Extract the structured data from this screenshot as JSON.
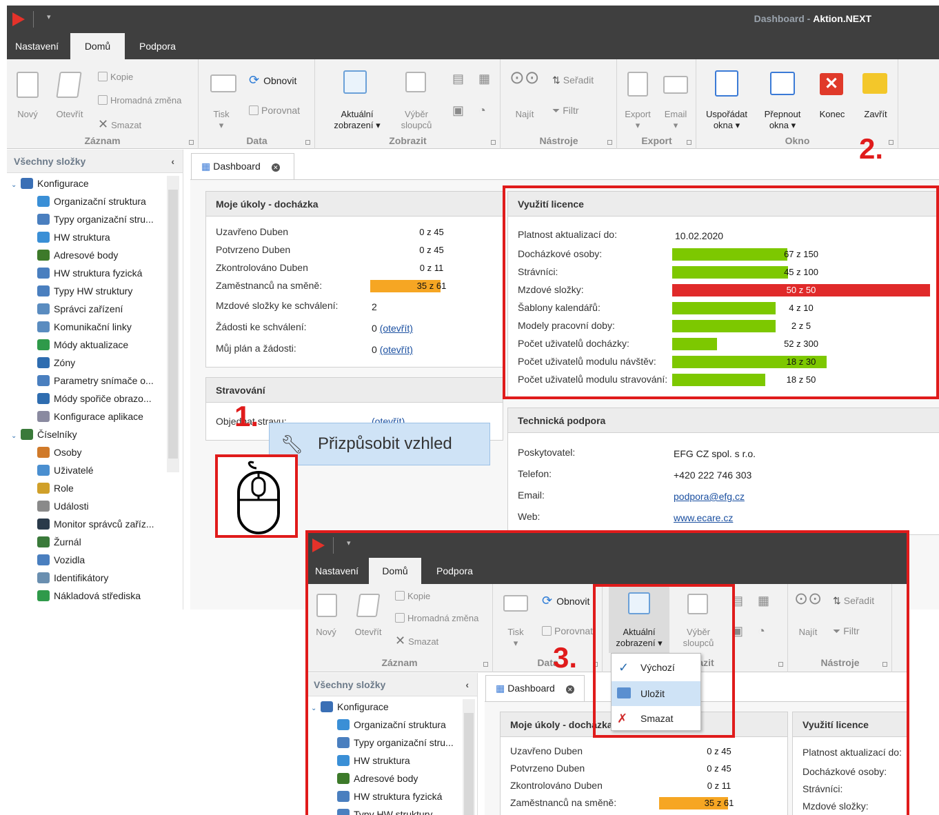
{
  "window": {
    "title_dim": "Dashboard",
    "title_sep": " - ",
    "title_app": "Aktion.NEXT"
  },
  "tabs": [
    "Nastavení",
    "Domů",
    "Podpora"
  ],
  "ribbon": {
    "zaznam": {
      "label": "Záznam",
      "novy": "Nový",
      "otevrit": "Otevřít",
      "kopie": "Kopie",
      "hromadna": "Hromadná změna",
      "smazat": "Smazat"
    },
    "data": {
      "label": "Data",
      "tisk": "Tisk",
      "obnovit": "Obnovit",
      "porovnat": "Porovnat"
    },
    "zobrazit": {
      "label": "Zobrazit",
      "aktualni": "Aktuální",
      "zobrazeni": "zobrazení",
      "vyber": "Výběr",
      "sloupcu": "sloupců"
    },
    "nastroje": {
      "label": "Nástroje",
      "najit": "Najít",
      "seradit": "Seřadit",
      "filtr": "Filtr"
    },
    "export": {
      "label": "Export",
      "export": "Export",
      "email": "Email"
    },
    "okno": {
      "label": "Okno",
      "usporadat": "Uspořádat",
      "okna": "okna",
      "prepnout": "Přepnout",
      "konec": "Konec",
      "zavrit": "Zavřít"
    }
  },
  "sidebar": {
    "header": "Všechny složky",
    "items": [
      {
        "label": "Konfigurace",
        "color": "#3a6fb5",
        "level": 0
      },
      {
        "label": "Organizační struktura",
        "color": "#3a8fd6",
        "level": 1
      },
      {
        "label": "Typy organizační stru...",
        "color": "#4a7fbf",
        "level": 1
      },
      {
        "label": "HW struktura",
        "color": "#3a8fd6",
        "level": 1
      },
      {
        "label": "Adresové body",
        "color": "#3d7a2a",
        "level": 1
      },
      {
        "label": "HW struktura fyzická",
        "color": "#4a7fbf",
        "level": 1
      },
      {
        "label": "Typy HW struktury",
        "color": "#4a7fbf",
        "level": 1
      },
      {
        "label": "Správci zařízení",
        "color": "#5a8cc0",
        "level": 1
      },
      {
        "label": "Komunikační linky",
        "color": "#5a8cc0",
        "level": 1
      },
      {
        "label": "Módy aktualizace",
        "color": "#2f9a4a",
        "level": 1
      },
      {
        "label": "Zóny",
        "color": "#2f6db0",
        "level": 1
      },
      {
        "label": "Parametry snímače o...",
        "color": "#4a7fbf",
        "level": 1
      },
      {
        "label": "Módy spořiče obrazo...",
        "color": "#2f6db0",
        "level": 1
      },
      {
        "label": "Konfigurace aplikace",
        "color": "#8a8aa0",
        "level": 1
      },
      {
        "label": "Číselníky",
        "color": "#3a7a3a",
        "level": 0
      },
      {
        "label": "Osoby",
        "color": "#d07a2a",
        "level": 1
      },
      {
        "label": "Uživatelé",
        "color": "#4a8fd0",
        "level": 1
      },
      {
        "label": "Role",
        "color": "#d0a02a",
        "level": 1
      },
      {
        "label": "Události",
        "color": "#8a8a8a",
        "level": 1
      },
      {
        "label": "Monitor správců zaříz...",
        "color": "#2a3a4a",
        "level": 1
      },
      {
        "label": "Žurnál",
        "color": "#3a7a3a",
        "level": 1
      },
      {
        "label": "Vozidla",
        "color": "#4a7fbf",
        "level": 1
      },
      {
        "label": "Identifikátory",
        "color": "#6a8fb0",
        "level": 1
      },
      {
        "label": "Nákladová střediska",
        "color": "#2f9a4a",
        "level": 1
      }
    ]
  },
  "doc_tab": "Dashboard",
  "ukoly": {
    "title": "Moje úkoly - docházka",
    "rows": [
      {
        "label": "Uzavřeno Duben",
        "value": "0 z 45"
      },
      {
        "label": "Potvrzeno Duben",
        "value": "0 z 45"
      },
      {
        "label": "Zkontrolováno Duben",
        "value": "0 z 11"
      },
      {
        "label": "Zaměstnanců na směně:",
        "value": "35 z 61",
        "progress": 0.574
      }
    ],
    "schvaleni_label": "Mzdové složky ke schválení:",
    "schvaleni_value": "2",
    "zadosti_label": "Žádosti ke schválení:",
    "zadosti_value": "0",
    "plan_label": "Můj plán a žádosti:",
    "plan_value": "0",
    "link": "(otevřít)"
  },
  "stravovani": {
    "title": "Stravování",
    "label": "Objednat stravu:",
    "link": "(otevřít)"
  },
  "licence": {
    "title": "Využití licence",
    "platnost_label": "Platnost aktualizací do:",
    "platnost_value": "10.02.2020",
    "rows": [
      {
        "label": "Docházkové osoby:",
        "value": "67 z 150",
        "progress": 0.4467,
        "color": "#7dc800"
      },
      {
        "label": "Strávníci:",
        "value": "45 z 100",
        "progress": 0.45,
        "color": "#7dc800"
      },
      {
        "label": "Mzdové složky:",
        "value": "50 z 50",
        "progress": 1.0,
        "color": "#e02a2a"
      },
      {
        "label": "Šablony kalendářů:",
        "value": "4 z 10",
        "progress": 0.4,
        "color": "#7dc800"
      },
      {
        "label": "Modely pracovní doby:",
        "value": "2 z 5",
        "progress": 0.4,
        "color": "#7dc800"
      },
      {
        "label": "Počet uživatelů docházky:",
        "value": "52 z 300",
        "progress": 0.1733,
        "color": "#7dc800"
      },
      {
        "label": "Počet uživatelů modulu návštěv:",
        "value": "18 z 30",
        "progress": 0.6,
        "color": "#7dc800"
      },
      {
        "label": "Počet uživatelů modulu stravování:",
        "value": "18 z 50",
        "progress": 0.36,
        "color": "#7dc800"
      }
    ]
  },
  "podpora": {
    "title": "Technická podpora",
    "rows": [
      {
        "label": "Poskytovatel:",
        "value": "EFG CZ spol. s r.o."
      },
      {
        "label": "Telefon:",
        "value": "+420 222 746 303"
      },
      {
        "label": "Email:",
        "value": "podpora@efg.cz"
      },
      {
        "label": "Web:",
        "value": "www.ecare.cz"
      }
    ]
  },
  "popup": {
    "label": "Přizpůsobit vzhled"
  },
  "steps": {
    "one": "1.",
    "two": "2.",
    "three": "3."
  },
  "menu": {
    "items": [
      "Výchozí",
      "Uložit",
      "Smazat"
    ]
  },
  "colors": {
    "orange": "#f6a623",
    "green": "#7dc800",
    "red": "#e02a2a",
    "annot": "#e01b1b"
  }
}
